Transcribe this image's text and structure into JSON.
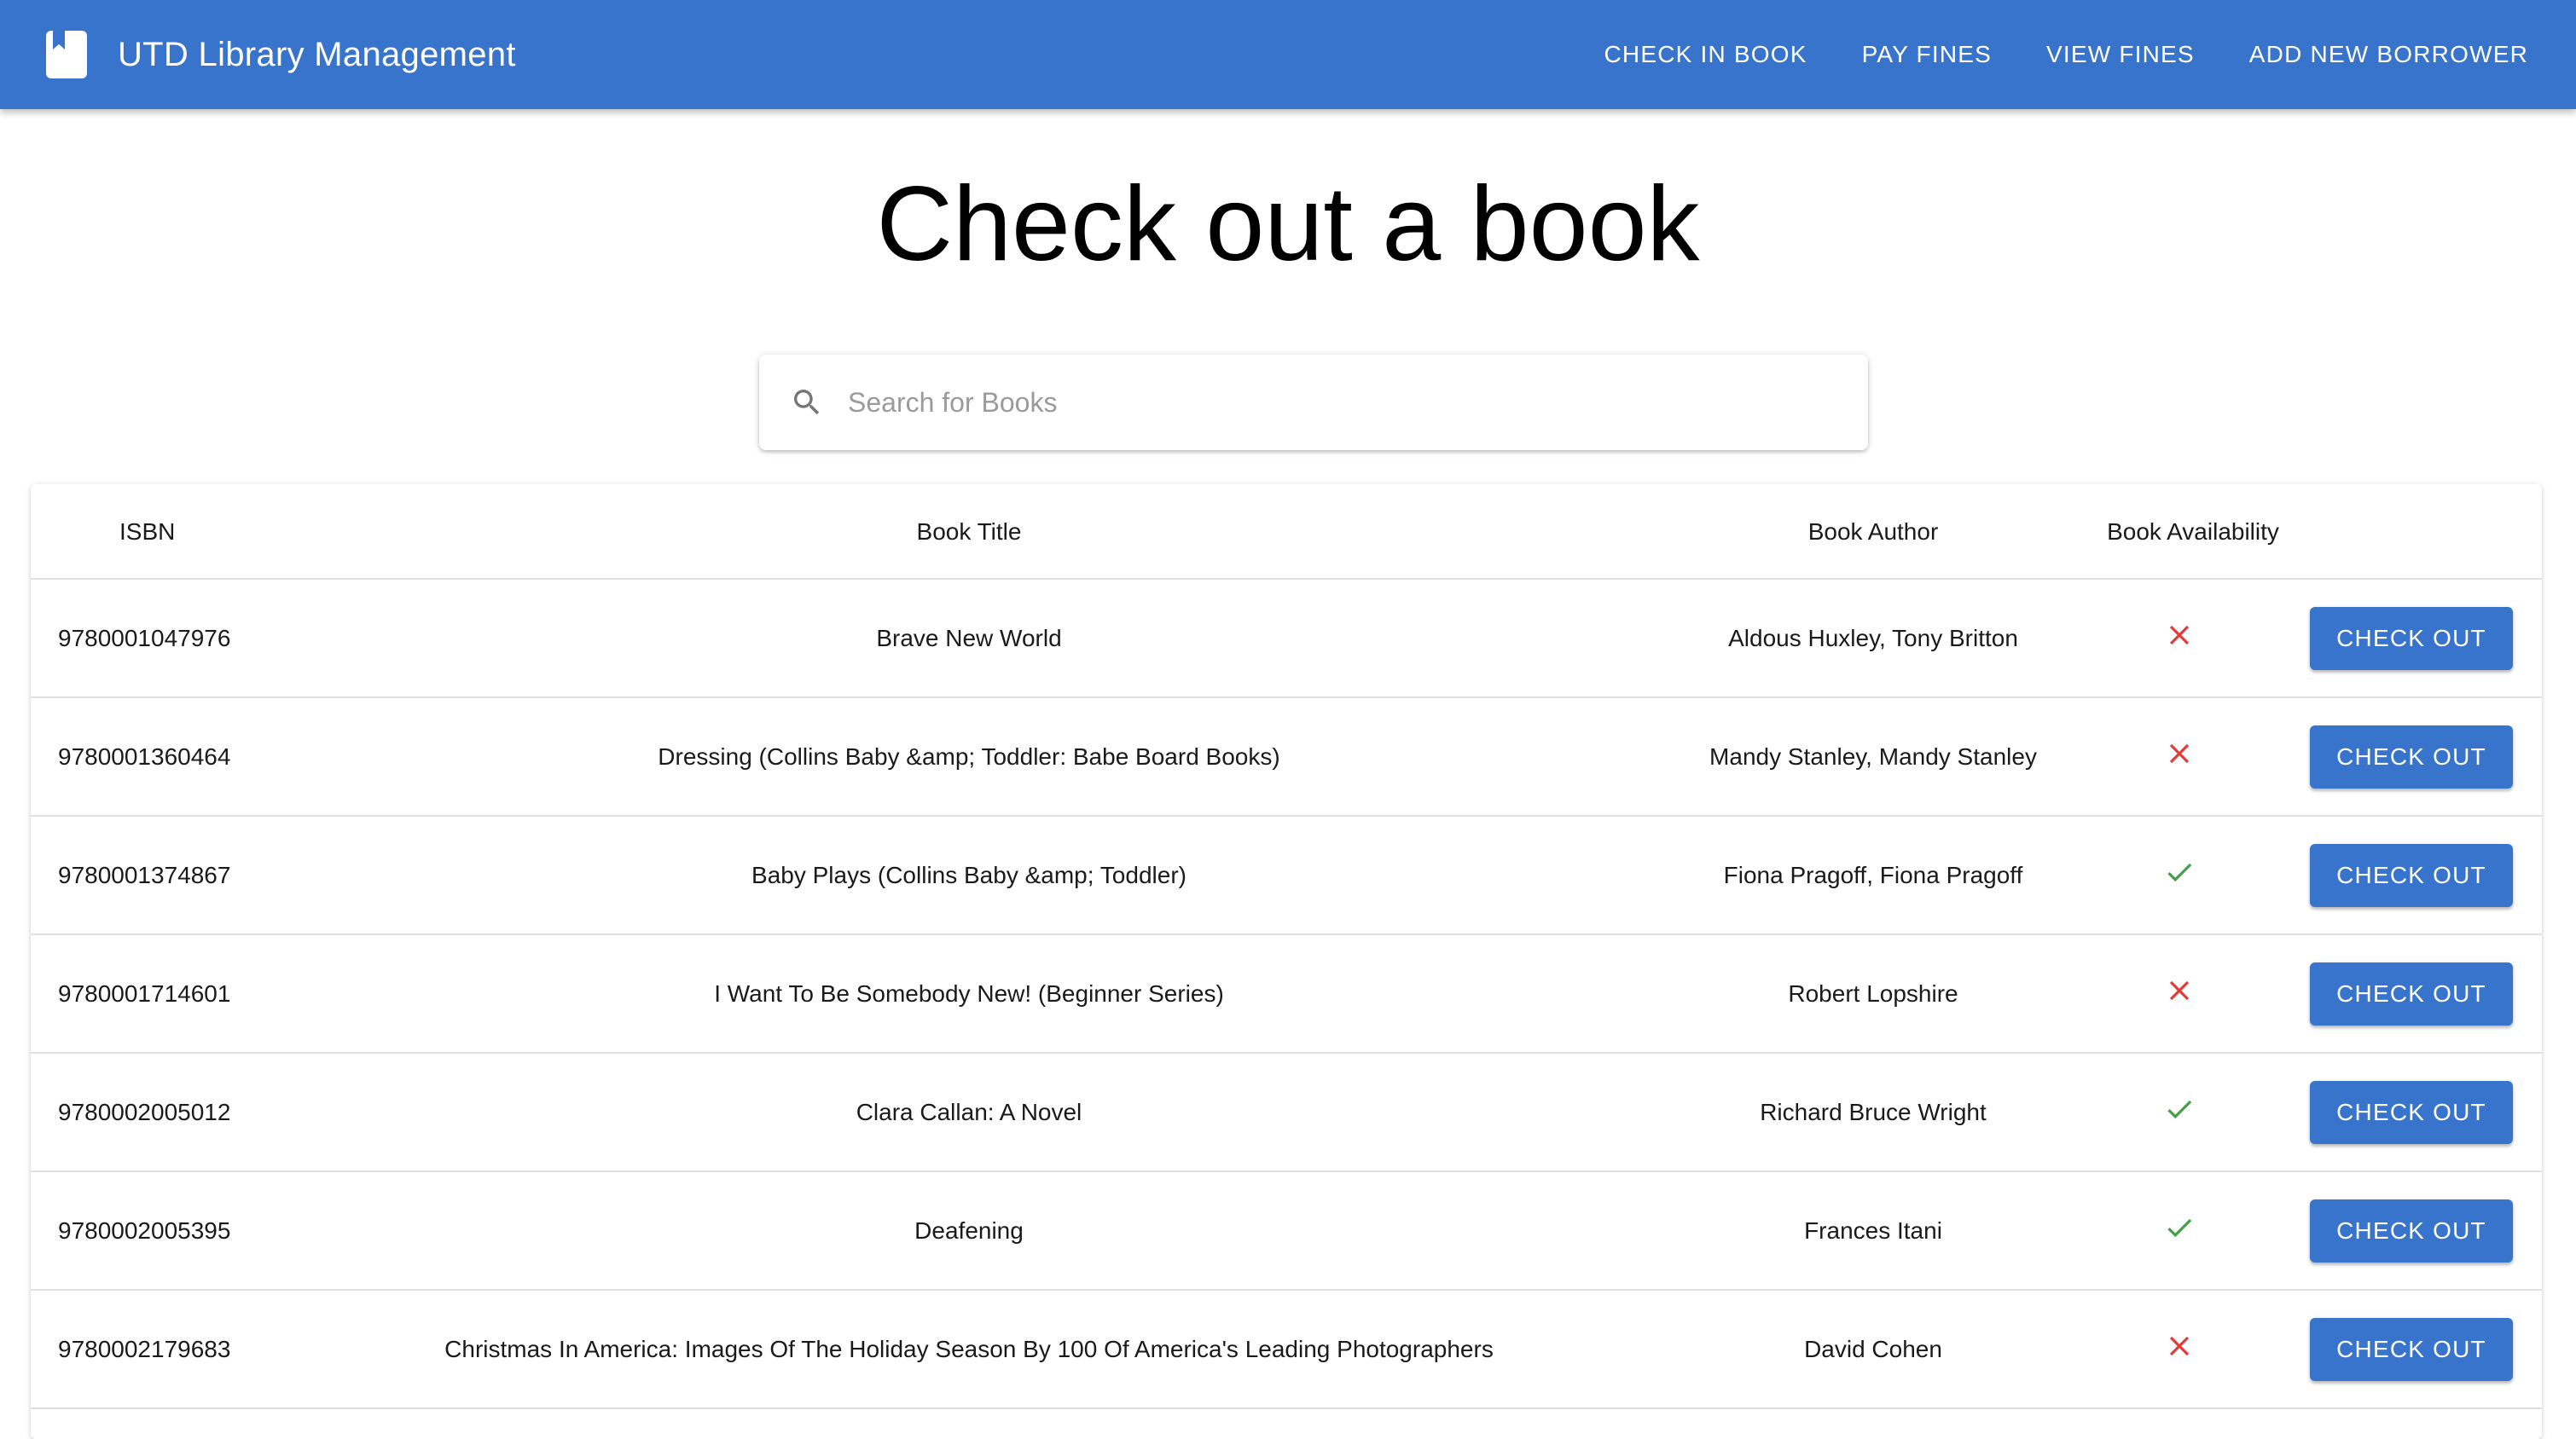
{
  "app": {
    "title": "UTD Library Management",
    "icon": "book-icon",
    "accent_color": "#3874cb"
  },
  "nav": {
    "items": [
      {
        "label": "CHECK IN BOOK"
      },
      {
        "label": "PAY FINES"
      },
      {
        "label": "VIEW FINES"
      },
      {
        "label": "ADD NEW BORROWER"
      }
    ]
  },
  "page": {
    "title": "Check out a book"
  },
  "search": {
    "icon": "search-icon",
    "placeholder": "Search for Books",
    "value": ""
  },
  "table": {
    "headers": {
      "isbn": "ISBN",
      "title": "Book Title",
      "author": "Book Author",
      "availability": "Book Availability"
    },
    "action_label": "CHECK OUT",
    "available_color": "#43a047",
    "unavailable_color": "#e53935",
    "rows": [
      {
        "isbn": "9780001047976",
        "title": "Brave New World",
        "author": "Aldous Huxley, Tony Britton",
        "available": false
      },
      {
        "isbn": "9780001360464",
        "title": "Dressing (Collins Baby &amp; Toddler: Babe Board Books)",
        "author": "Mandy Stanley, Mandy Stanley",
        "available": false
      },
      {
        "isbn": "9780001374867",
        "title": "Baby Plays (Collins Baby &amp; Toddler)",
        "author": "Fiona Pragoff, Fiona Pragoff",
        "available": true
      },
      {
        "isbn": "9780001714601",
        "title": "I Want To Be Somebody New! (Beginner Series)",
        "author": "Robert Lopshire",
        "available": false
      },
      {
        "isbn": "9780002005012",
        "title": "Clara Callan: A Novel",
        "author": "Richard Bruce Wright",
        "available": true
      },
      {
        "isbn": "9780002005395",
        "title": "Deafening",
        "author": "Frances Itani",
        "available": true
      },
      {
        "isbn": "9780002179683",
        "title": "Christmas In America: Images Of The Holiday Season By 100 Of America's Leading Photographers",
        "author": "David Cohen",
        "available": false
      }
    ]
  }
}
